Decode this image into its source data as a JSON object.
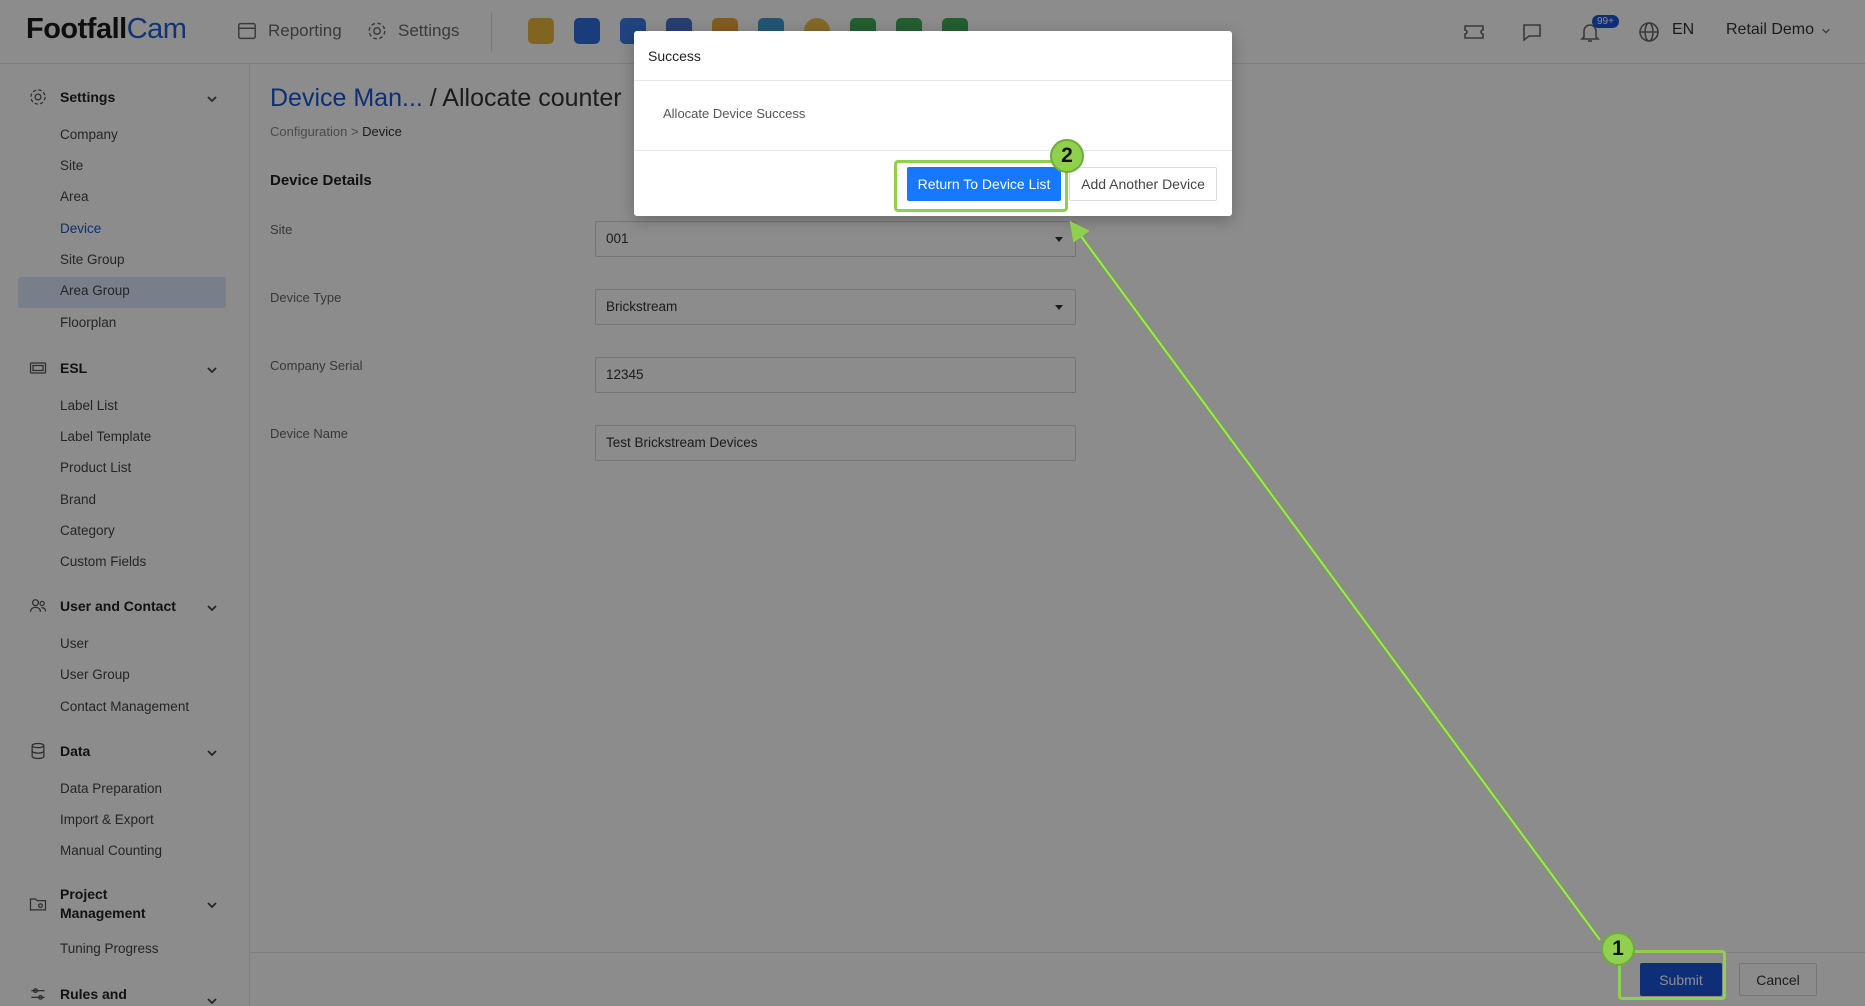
{
  "brand": {
    "name_part1": "Footfall",
    "name_part2": "Cam"
  },
  "topnav": {
    "reporting": "Reporting",
    "settings": "Settings"
  },
  "header": {
    "notification_badge": "99+",
    "language": "EN",
    "user": "Retail Demo"
  },
  "sidebar": {
    "groups": [
      {
        "label": "Settings",
        "items": [
          "Company",
          "Site",
          "Area",
          "Device",
          "Site Group",
          "Area Group",
          "Floorplan"
        ]
      },
      {
        "label": "ESL",
        "items": [
          "Label List",
          "Label Template",
          "Product List",
          "Brand",
          "Category",
          "Custom Fields"
        ]
      },
      {
        "label": "User and Contact",
        "items": [
          "User",
          "User Group",
          "Contact Management"
        ]
      },
      {
        "label": "Data",
        "items": [
          "Data Preparation",
          "Import & Export",
          "Manual Counting"
        ]
      },
      {
        "label": "Project Management",
        "items": [
          "Tuning Progress"
        ]
      },
      {
        "label": "Rules and",
        "items": []
      }
    ],
    "active_item": "Device"
  },
  "page": {
    "title_link": "Device Man...",
    "title_rest": " / Allocate counter",
    "breadcrumb_root": "Configuration",
    "breadcrumb_sep": ">",
    "breadcrumb_current": "Device",
    "section": "Device Details"
  },
  "form": {
    "site_label": "Site",
    "site_value": "001",
    "device_type_label": "Device Type",
    "device_type_value": "Brickstream",
    "company_serial_label": "Company Serial",
    "company_serial_value": "12345",
    "device_name_label": "Device Name",
    "device_name_value": "Test Brickstream Devices"
  },
  "footer": {
    "submit": "Submit",
    "cancel": "Cancel"
  },
  "modal": {
    "title": "Success",
    "message": "Allocate Device Success",
    "primary": "Return To Device List",
    "secondary": "Add Another Device"
  },
  "annotations": {
    "step1": "1",
    "step2": "2",
    "color": "#8fd14f"
  },
  "icons": [
    "reporting-icon",
    "settings-gear-icon",
    "ticket-icon",
    "chat-icon",
    "bell-icon",
    "globe-icon",
    "chevron-down-icon"
  ]
}
